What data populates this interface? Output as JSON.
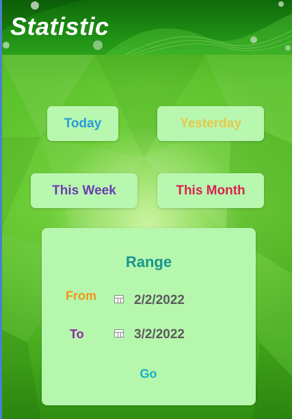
{
  "header": {
    "title": "Statistic"
  },
  "quick_ranges": {
    "today": {
      "label": "Today",
      "color": "#2b9bd6"
    },
    "yesterday": {
      "label": "Yesterday",
      "color": "#e6c84a"
    },
    "this_week": {
      "label": "This Week",
      "color": "#6a3db0"
    },
    "this_month": {
      "label": "This Month",
      "color": "#d9234f"
    }
  },
  "range": {
    "title": "Range",
    "from_label": "From",
    "from_value": "2/2/2022",
    "to_label": "To",
    "to_value": "3/2/2022",
    "go_label": "Go"
  },
  "colors": {
    "from_label": "#f2941c",
    "to_label": "#8e2aa3",
    "range_title": "#17968d",
    "go": "#17b1c2",
    "button_bg": "#b8f7b0"
  },
  "icons": {
    "date_picker": "calendar-icon"
  }
}
